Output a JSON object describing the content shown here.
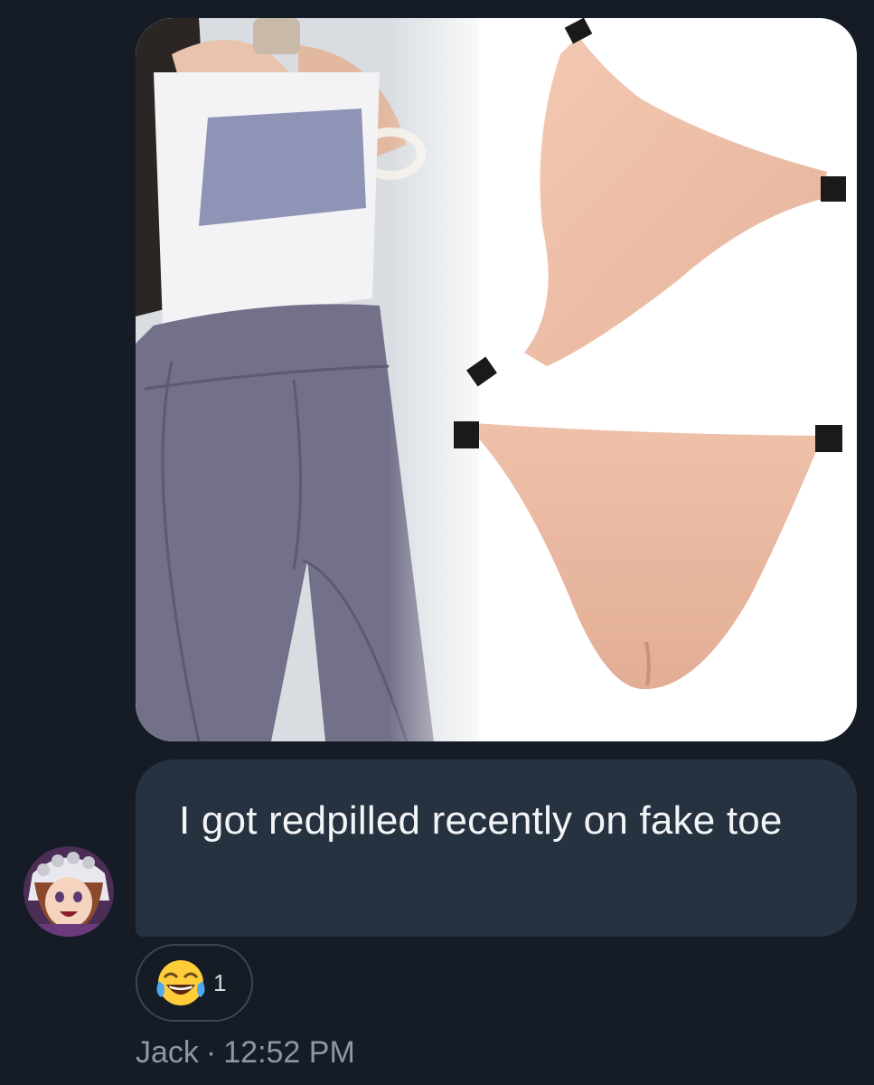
{
  "message": {
    "text": "I got redpilled recently on fake toe",
    "author": "Jack",
    "separator": "·",
    "time": "12:52 PM"
  },
  "reaction": {
    "emoji": "face-with-tears-of-joy-icon",
    "count": "1"
  },
  "colors": {
    "background": "#151c26",
    "bubble": "#273240",
    "meta_text": "#8b98a5"
  }
}
